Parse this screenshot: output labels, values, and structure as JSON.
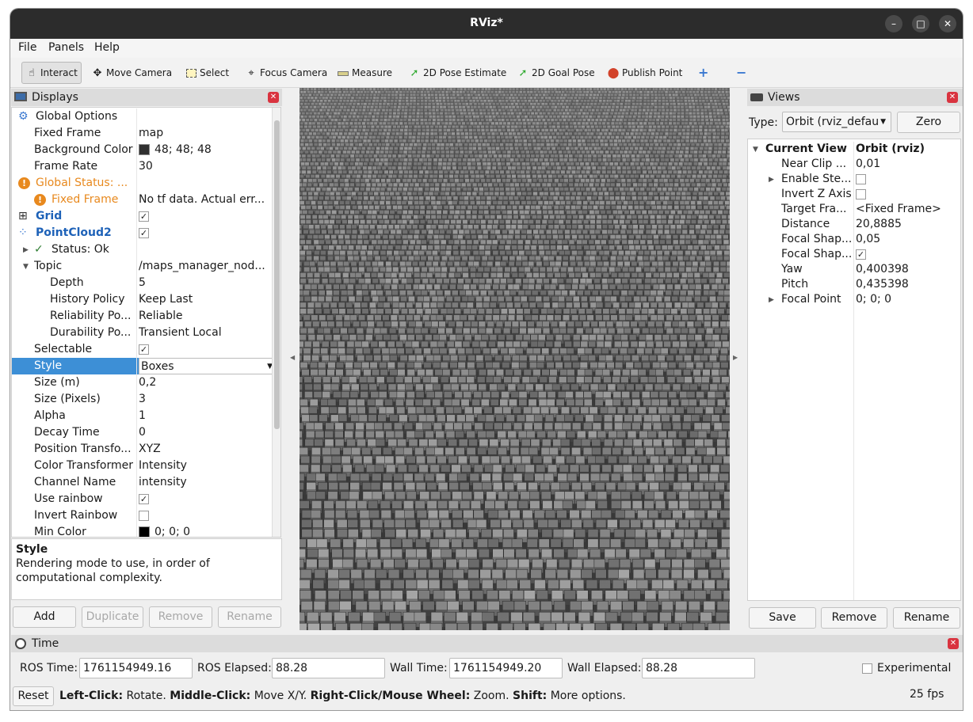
{
  "window": {
    "title": "RViz*",
    "controls": {
      "minimize": "–",
      "maximize": "□",
      "close": "✕"
    }
  },
  "menubar": [
    "File",
    "Panels",
    "Help"
  ],
  "toolbar": {
    "tools": [
      {
        "label": "Interact",
        "icon": "hand-icon",
        "active": true
      },
      {
        "label": "Move Camera",
        "icon": "move-camera-icon"
      },
      {
        "label": "Select",
        "icon": "select-icon"
      },
      {
        "label": "Focus Camera",
        "icon": "focus-camera-icon"
      },
      {
        "label": "Measure",
        "icon": "ruler-icon"
      },
      {
        "label": "2D Pose Estimate",
        "icon": "green-arrow-icon"
      },
      {
        "label": "2D Goal Pose",
        "icon": "green-arrow-icon"
      },
      {
        "label": "Publish Point",
        "icon": "map-pin-icon"
      }
    ],
    "add_icon": "plus-icon",
    "remove_icon": "minus-icon"
  },
  "displays": {
    "title": "Displays",
    "rows": [
      {
        "key": "Global Options",
        "value": "",
        "indent": 0,
        "icon": "gear-icon"
      },
      {
        "key": "Fixed Frame",
        "value": "map",
        "indent": 1
      },
      {
        "key": "Background Color",
        "value": "48; 48; 48",
        "indent": 1,
        "swatch": "#303030"
      },
      {
        "key": "Frame Rate",
        "value": "30",
        "indent": 1
      },
      {
        "key": "Global Status: ...",
        "value": "",
        "indent": 0,
        "icon": "warning-icon",
        "status": "warn"
      },
      {
        "key": "Fixed Frame",
        "value": "No tf data.  Actual err...",
        "indent": 1,
        "icon": "warning-icon",
        "status": "warn"
      },
      {
        "key": "Grid",
        "value": "",
        "indent": 0,
        "icon": "grid-icon",
        "check": true,
        "bold": true
      },
      {
        "key": "PointCloud2",
        "value": "",
        "indent": 0,
        "icon": "pointcloud-icon",
        "check": true,
        "bold": true
      },
      {
        "key": "Status: Ok",
        "value": "",
        "indent": 1,
        "icon": "check-icon",
        "expander": "closed"
      },
      {
        "key": "Topic",
        "value": "/maps_manager_nod...",
        "indent": 1,
        "expander": "open"
      },
      {
        "key": "Depth",
        "value": "5",
        "indent": 2
      },
      {
        "key": "History Policy",
        "value": "Keep Last",
        "indent": 2
      },
      {
        "key": "Reliability Po...",
        "value": "Reliable",
        "indent": 2
      },
      {
        "key": "Durability Po...",
        "value": "Transient Local",
        "indent": 2
      },
      {
        "key": "Selectable",
        "value": "",
        "indent": 1,
        "check": true
      },
      {
        "key": "Style",
        "value": "Boxes",
        "indent": 1,
        "selected": true,
        "dropdown": true
      },
      {
        "key": "Size (m)",
        "value": "0,2",
        "indent": 1
      },
      {
        "key": "Size (Pixels)",
        "value": "3",
        "indent": 1
      },
      {
        "key": "Alpha",
        "value": "1",
        "indent": 1
      },
      {
        "key": "Decay Time",
        "value": "0",
        "indent": 1
      },
      {
        "key": "Position Transfo...",
        "value": "XYZ",
        "indent": 1
      },
      {
        "key": "Color Transformer",
        "value": "Intensity",
        "indent": 1
      },
      {
        "key": "Channel Name",
        "value": "intensity",
        "indent": 1
      },
      {
        "key": "Use rainbow",
        "value": "",
        "indent": 1,
        "check": true
      },
      {
        "key": "Invert Rainbow",
        "value": "",
        "indent": 1,
        "check": false
      },
      {
        "key": "Min Color",
        "value": "0; 0; 0",
        "indent": 1,
        "swatch": "#000000"
      }
    ],
    "description": {
      "title": "Style",
      "text": "Rendering mode to use, in order of computational complexity."
    },
    "buttons": {
      "add": "Add",
      "duplicate": "Duplicate",
      "remove": "Remove",
      "rename": "Rename"
    }
  },
  "views": {
    "title": "Views",
    "type_label": "Type:",
    "type_value": "Orbit (rviz_defau",
    "zero": "Zero",
    "header": {
      "key": "Current View",
      "value": "Orbit (rviz)"
    },
    "rows": [
      {
        "key": "Near Clip ...",
        "value": "0,01"
      },
      {
        "key": "Enable Ste...",
        "value": "",
        "check": false,
        "expander": "closed"
      },
      {
        "key": "Invert Z Axis",
        "value": "",
        "check": false
      },
      {
        "key": "Target Fra...",
        "value": "<Fixed Frame>"
      },
      {
        "key": "Distance",
        "value": "20,8885"
      },
      {
        "key": "Focal Shap...",
        "value": "0,05"
      },
      {
        "key": "Focal Shap...",
        "value": "",
        "check": true
      },
      {
        "key": "Yaw",
        "value": "0,400398"
      },
      {
        "key": "Pitch",
        "value": "0,435398"
      },
      {
        "key": "Focal Point",
        "value": "0; 0; 0",
        "expander": "closed"
      }
    ],
    "buttons": {
      "save": "Save",
      "remove": "Remove",
      "rename": "Rename"
    }
  },
  "time": {
    "title": "Time",
    "ros_time_label": "ROS Time:",
    "ros_time": "1761154949.16",
    "ros_elapsed_label": "ROS Elapsed:",
    "ros_elapsed": "88.28",
    "wall_time_label": "Wall Time:",
    "wall_time": "1761154949.20",
    "wall_elapsed_label": "Wall Elapsed:",
    "wall_elapsed": "88.28",
    "experimental": "Experimental"
  },
  "statusbar": {
    "reset": "Reset",
    "hint_parts": [
      {
        "b": "Left-Click:",
        "t": " Rotate. "
      },
      {
        "b": "Middle-Click:",
        "t": " Move X/Y. "
      },
      {
        "b": "Right-Click/Mouse Wheel:",
        "t": " Zoom. "
      },
      {
        "b": "Shift:",
        "t": " More options."
      }
    ],
    "fps": "25 fps"
  },
  "colors": {
    "warn": "#e8891e",
    "link": "#1e62b8",
    "selected": "#3d8fd6",
    "titlebar": "#2c2c2c",
    "background": "#303030"
  }
}
